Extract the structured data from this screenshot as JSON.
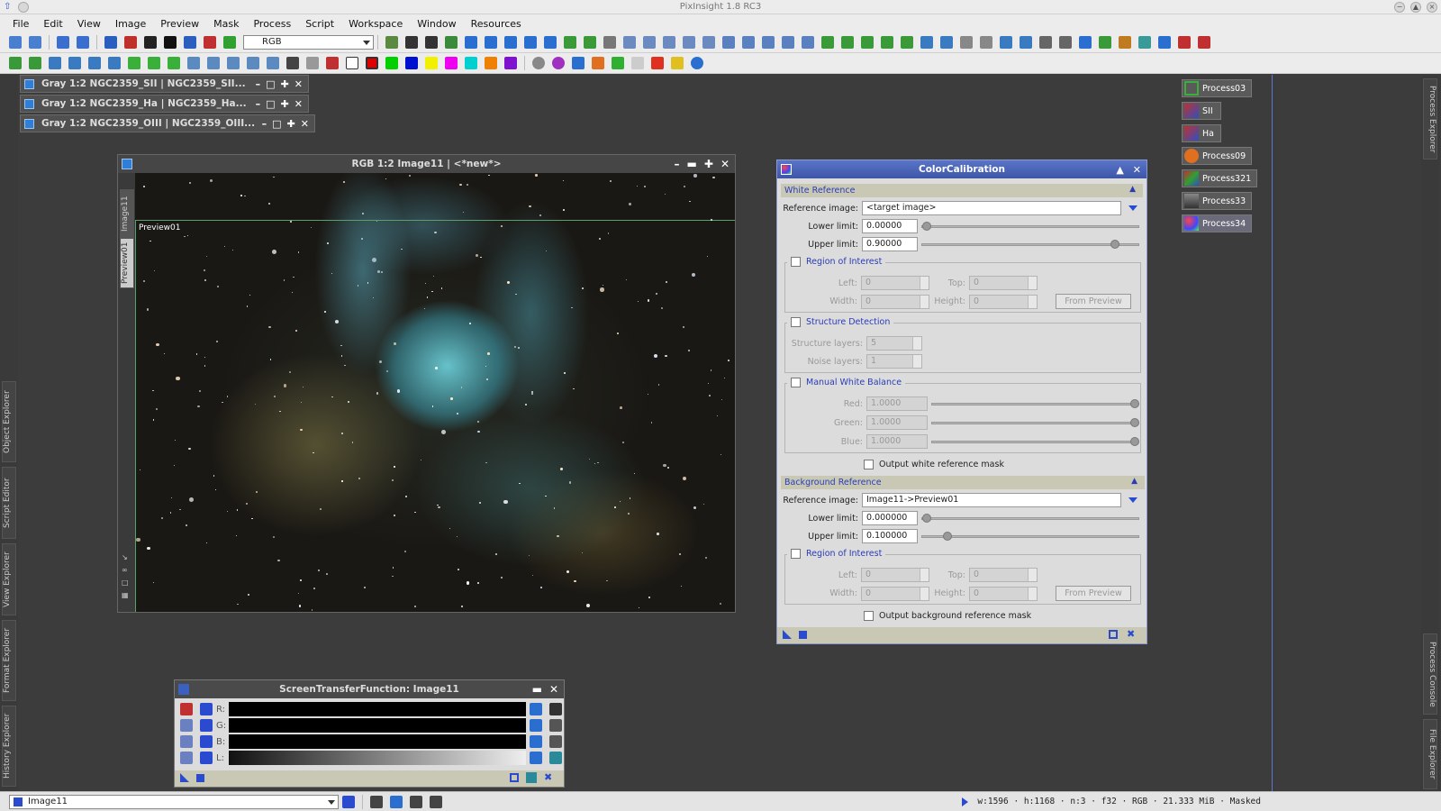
{
  "app": {
    "title": "PixInsight 1.8 RC3"
  },
  "menu": [
    "File",
    "Edit",
    "View",
    "Image",
    "Preview",
    "Mask",
    "Process",
    "Script",
    "Workspace",
    "Window",
    "Resources"
  ],
  "toolbar": {
    "channel_combo": "RGB"
  },
  "iconified_windows": [
    {
      "title": "Gray 1:2 NGC2359_SII | NGC2359_SII..."
    },
    {
      "title": "Gray 1:2 NGC2359_Ha | NGC2359_Ha..."
    },
    {
      "title": "Gray 1:2 NGC2359_OIII | NGC2359_OIII..."
    }
  ],
  "image_window": {
    "title": "RGB 1:2 Image11 | <*new*>",
    "tabs": [
      "Image11",
      "Preview01"
    ],
    "preview_label": "Preview01"
  },
  "color_calibration": {
    "title": "ColorCalibration",
    "white_reference": {
      "section": "White Reference",
      "reference_image_label": "Reference image:",
      "reference_image": "<target image>",
      "lower_limit_label": "Lower limit:",
      "lower_limit": "0.00000",
      "upper_limit_label": "Upper limit:",
      "upper_limit": "0.90000",
      "upper_limit_fraction": 0.9,
      "roi": {
        "label": "Region of Interest",
        "left_label": "Left:",
        "left": "0",
        "top_label": "Top:",
        "top": "0",
        "width_label": "Width:",
        "width": "0",
        "height_label": "Height:",
        "height": "0",
        "from_preview": "From Preview"
      },
      "structure": {
        "label": "Structure Detection",
        "layers_label": "Structure layers:",
        "layers": "5",
        "noise_label": "Noise layers:",
        "noise": "1"
      },
      "manual_wb": {
        "label": "Manual White Balance",
        "red_label": "Red:",
        "red": "1.0000",
        "green_label": "Green:",
        "green": "1.0000",
        "blue_label": "Blue:",
        "blue": "1.0000"
      },
      "output_mask": "Output white reference mask"
    },
    "background_reference": {
      "section": "Background Reference",
      "reference_image_label": "Reference image:",
      "reference_image": "Image11->Preview01",
      "lower_limit_label": "Lower limit:",
      "lower_limit": "0.000000",
      "upper_limit_label": "Upper limit:",
      "upper_limit": "0.100000",
      "upper_limit_fraction": 0.1,
      "roi": {
        "label": "Region of Interest",
        "left_label": "Left:",
        "left": "0",
        "top_label": "Top:",
        "top": "0",
        "width_label": "Width:",
        "width": "0",
        "height_label": "Height:",
        "height": "0",
        "from_preview": "From Preview"
      },
      "output_mask": "Output background reference mask"
    }
  },
  "stf": {
    "title": "ScreenTransferFunction: Image11",
    "channels": [
      "R:",
      "G:",
      "B:",
      "L:"
    ]
  },
  "process_icons": [
    "Process03",
    "SII",
    "Ha",
    "Process09",
    "Process321",
    "Process33",
    "Process34"
  ],
  "left_dock": [
    "Object Explorer",
    "Script Editor",
    "View Explorer",
    "Format Explorer",
    "History Explorer"
  ],
  "right_dock": [
    "Process Explorer",
    "Process Console",
    "File Explorer"
  ],
  "statusbar": {
    "view": "Image11",
    "info": "w:1596 · h:1168 · n:3 · f32 · RGB · 21.333 MiB · Masked"
  }
}
